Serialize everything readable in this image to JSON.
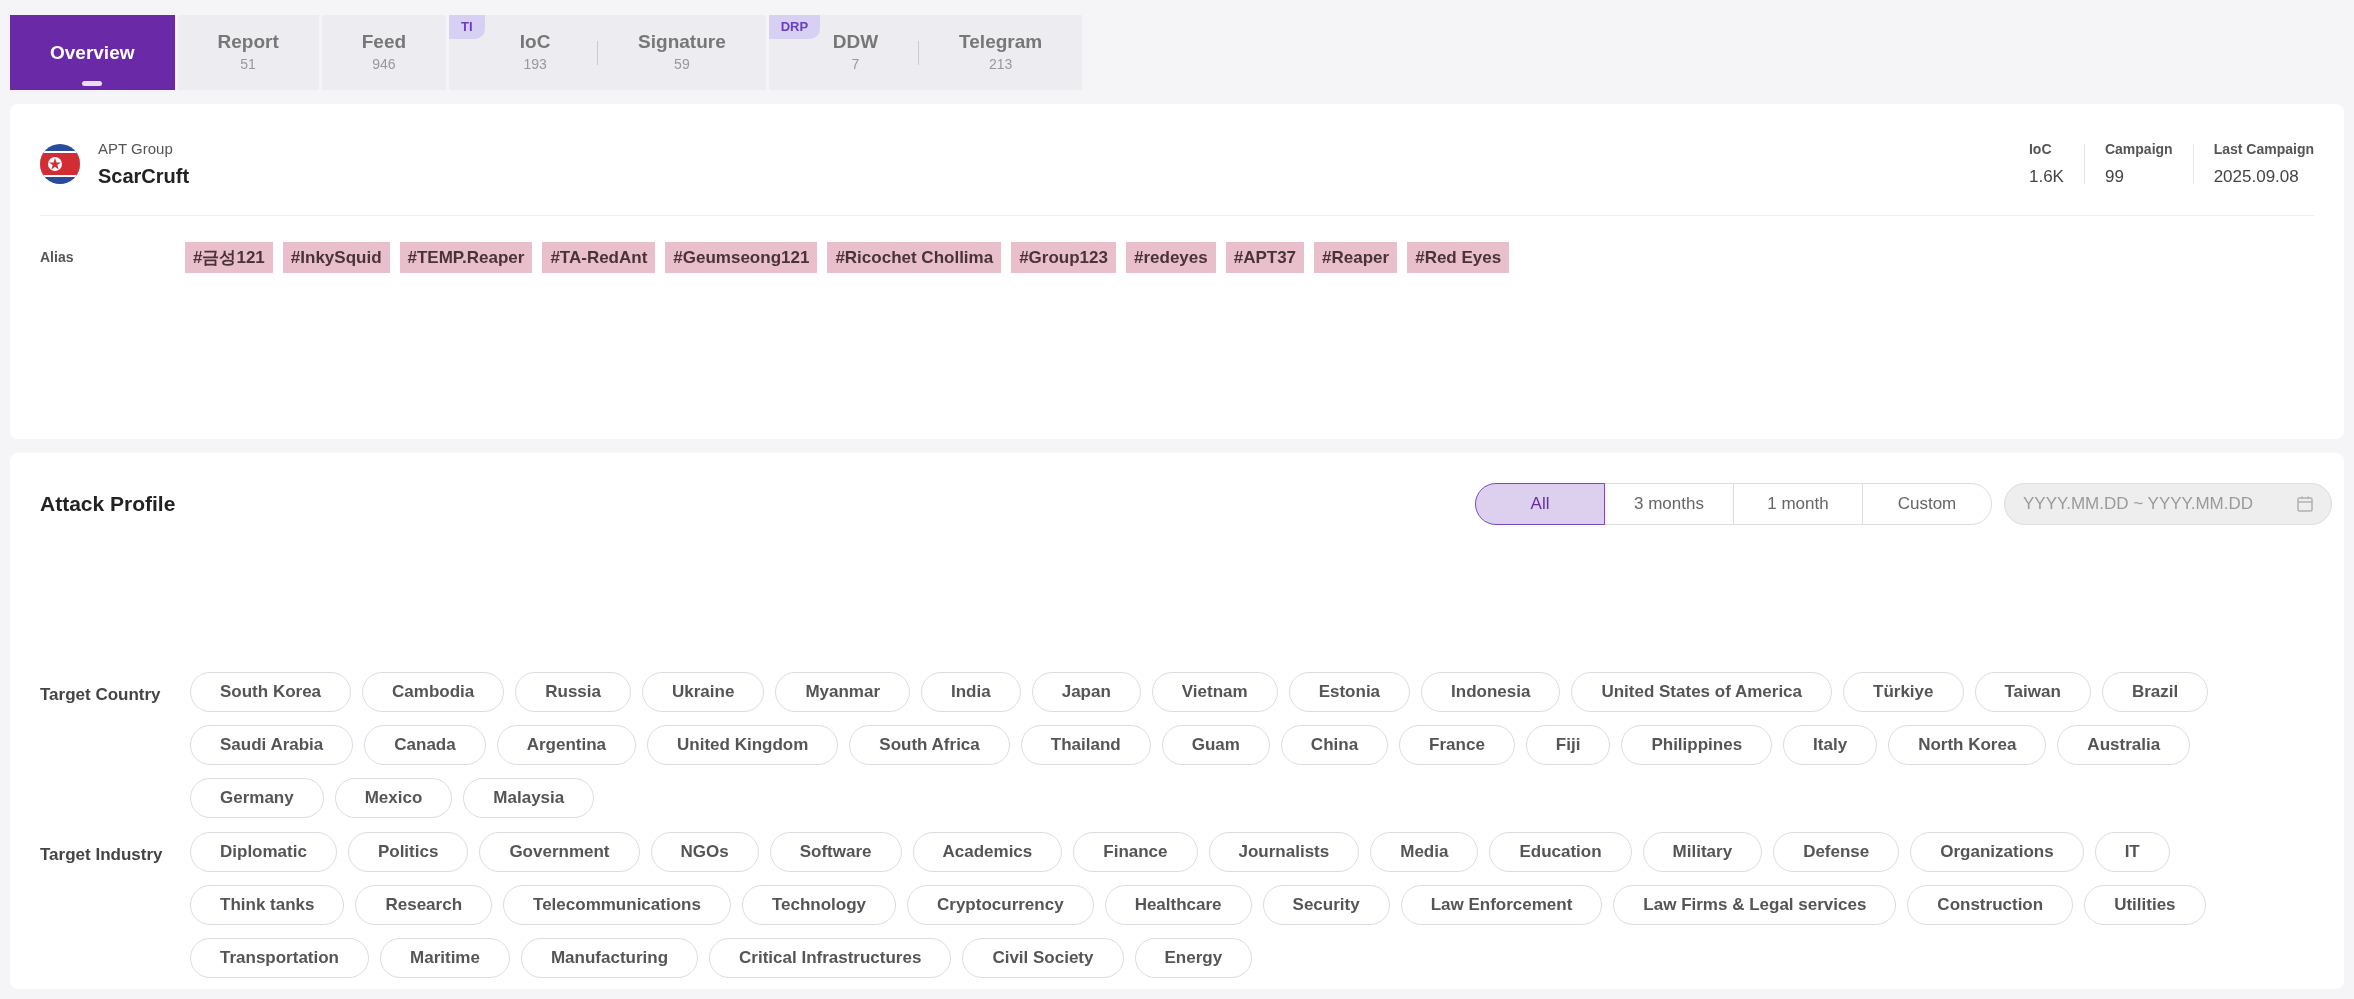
{
  "tab_groups": [
    {
      "tabs": [
        {
          "label": "Overview",
          "selected": true
        }
      ]
    },
    {
      "tabs": [
        {
          "label": "Report",
          "count": "51",
          "selected": false
        }
      ]
    },
    {
      "tabs": [
        {
          "label": "Feed",
          "count": "946",
          "selected": false
        }
      ]
    },
    {
      "badge": "TI",
      "tabs": [
        {
          "label": "IoC",
          "count": "193",
          "selected": false
        },
        {
          "label": "Signature",
          "count": "59",
          "selected": false
        }
      ]
    },
    {
      "badge": "DRP",
      "tabs": [
        {
          "label": "DDW",
          "count": "7",
          "selected": false
        },
        {
          "label": "Telegram",
          "count": "213",
          "selected": false
        }
      ]
    }
  ],
  "profile": {
    "type": "APT Group",
    "name": "ScarCruft",
    "stats": [
      {
        "label": "IoC",
        "value": "1.6K"
      },
      {
        "label": "Campaign",
        "value": "99"
      },
      {
        "label": "Last Campaign",
        "value": "2025.09.08"
      }
    ],
    "alias_label": "Alias",
    "aliases": [
      "#금성121",
      "#InkySquid",
      "#TEMP.Reaper",
      "#TA-RedAnt",
      "#Geumseong121",
      "#Ricochet Chollima",
      "#Group123",
      "#redeyes",
      "#APT37",
      "#Reaper",
      "#Red Eyes"
    ]
  },
  "attack_profile": {
    "title": "Attack Profile",
    "periods": [
      {
        "label": "All",
        "selected": true
      },
      {
        "label": "3 months",
        "selected": false
      },
      {
        "label": "1 month",
        "selected": false
      },
      {
        "label": "Custom",
        "selected": false
      }
    ],
    "date_range": {
      "placeholder": "YYYY.MM.DD ~ YYYY.MM.DD",
      "disabled": true
    },
    "targets": [
      {
        "label": "Target Country",
        "items": [
          "South Korea",
          "Cambodia",
          "Russia",
          "Ukraine",
          "Myanmar",
          "India",
          "Japan",
          "Vietnam",
          "Estonia",
          "Indonesia",
          "United States of America",
          "Türkiye",
          "Taiwan",
          "Brazil",
          "Saudi Arabia",
          "Canada",
          "Argentina",
          "United Kingdom",
          "South Africa",
          "Thailand",
          "Guam",
          "China",
          "France",
          "Fiji",
          "Philippines",
          "Italy",
          "North Korea",
          "Australia",
          "Germany",
          "Mexico",
          "Malaysia"
        ]
      },
      {
        "label": "Target Industry",
        "items": [
          "Diplomatic",
          "Politics",
          "Government",
          "NGOs",
          "Software",
          "Academics",
          "Finance",
          "Journalists",
          "Media",
          "Education",
          "Military",
          "Defense",
          "Organizations",
          "IT",
          "Think tanks",
          "Research",
          "Telecommunications",
          "Technology",
          "Cryptocurrency",
          "Healthcare",
          "Security",
          "Law Enforcement",
          "Law Firms & Legal services",
          "Construction",
          "Utilities",
          "Transportation",
          "Maritime",
          "Manufacturing",
          "Critical Infrastructures",
          "Civil Society",
          "Energy"
        ]
      }
    ]
  }
}
